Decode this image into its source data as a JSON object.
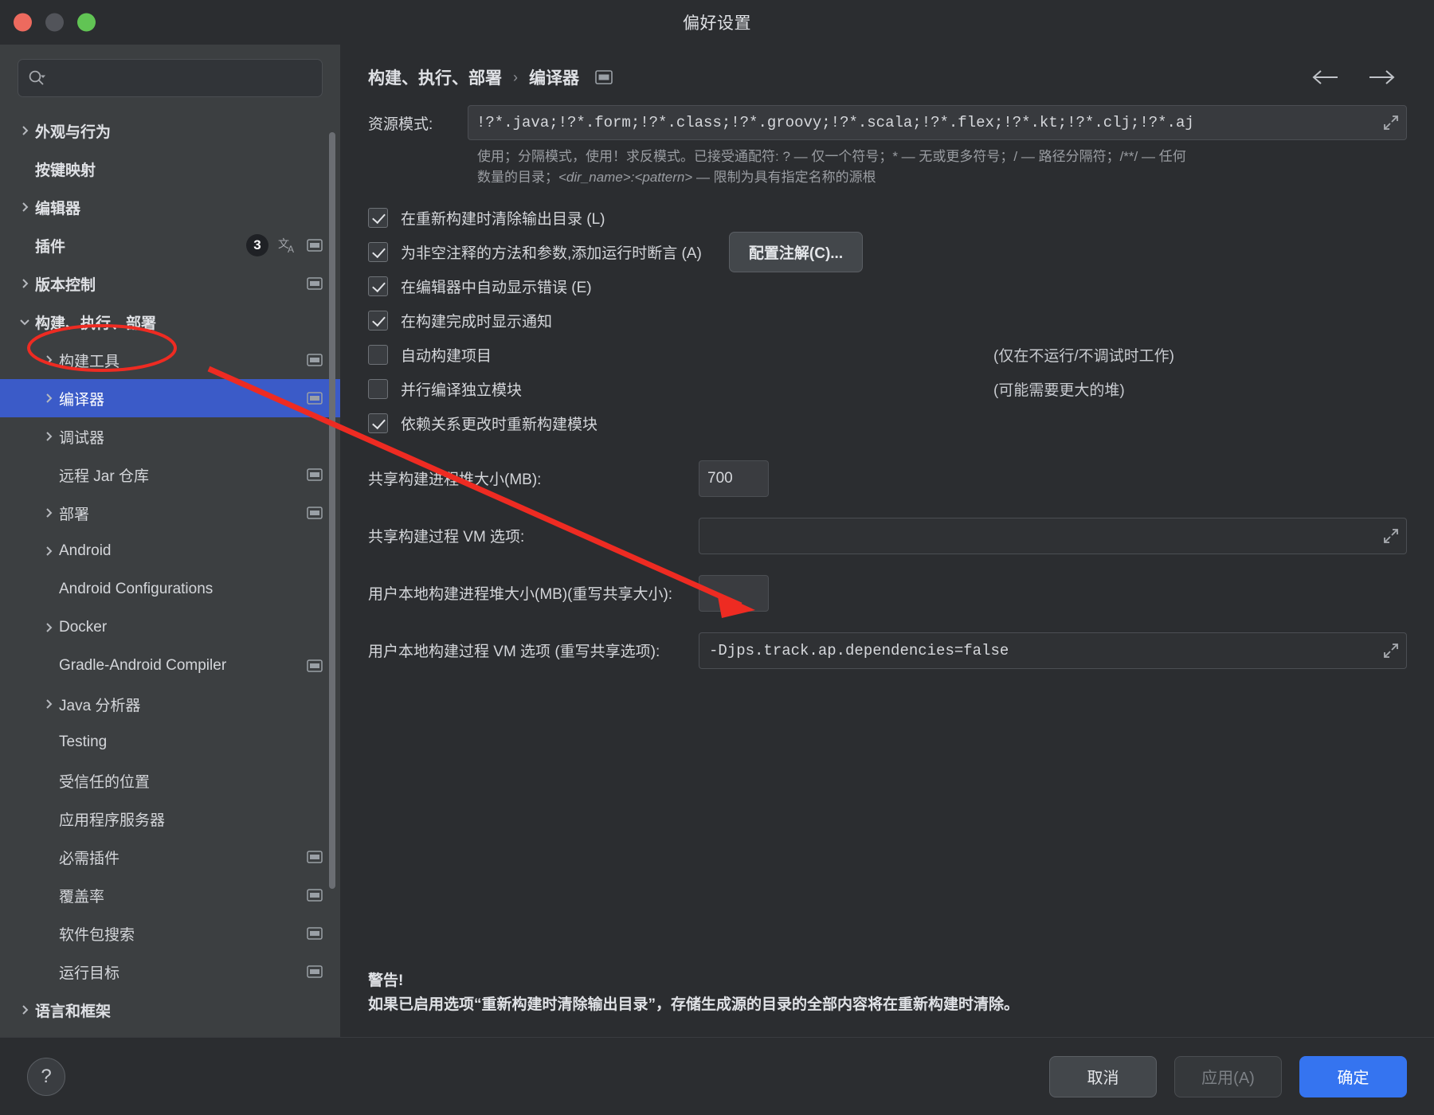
{
  "window": {
    "title": "偏好设置",
    "traffic_lights": [
      "close-red",
      "minimize-yellow",
      "zoom-green"
    ]
  },
  "sidebar": {
    "search": {
      "value": "",
      "placeholder": ""
    },
    "items": [
      {
        "label": "外观与行为",
        "level": 0,
        "chevron": "right",
        "bold": true,
        "icons": []
      },
      {
        "label": "按键映射",
        "level": 0,
        "chevron": "none",
        "bold": true,
        "icons": []
      },
      {
        "label": "编辑器",
        "level": 0,
        "chevron": "right",
        "bold": true,
        "icons": []
      },
      {
        "label": "插件",
        "level": 0,
        "chevron": "none",
        "bold": true,
        "badge": "3",
        "icons": [
          "translate-icon",
          "window-icon"
        ]
      },
      {
        "label": "版本控制",
        "level": 0,
        "chevron": "right",
        "bold": true,
        "icons": [
          "window-icon"
        ]
      },
      {
        "label": "构建、执行、部署",
        "level": 0,
        "chevron": "down",
        "bold": true,
        "icons": []
      },
      {
        "label": "构建工具",
        "level": 1,
        "chevron": "right",
        "bold": false,
        "icons": [
          "window-icon"
        ]
      },
      {
        "label": "编译器",
        "level": 1,
        "chevron": "right",
        "bold": false,
        "selected": true,
        "icons": [
          "window-icon"
        ]
      },
      {
        "label": "调试器",
        "level": 1,
        "chevron": "right",
        "bold": false,
        "icons": []
      },
      {
        "label": "远程 Jar 仓库",
        "level": 1,
        "chevron": "none",
        "bold": false,
        "icons": [
          "window-icon"
        ]
      },
      {
        "label": "部署",
        "level": 1,
        "chevron": "right",
        "bold": false,
        "icons": [
          "window-icon"
        ]
      },
      {
        "label": "Android",
        "level": 1,
        "chevron": "right",
        "bold": false,
        "icons": []
      },
      {
        "label": "Android Configurations",
        "level": 1,
        "chevron": "none",
        "bold": false,
        "icons": []
      },
      {
        "label": "Docker",
        "level": 1,
        "chevron": "right",
        "bold": false,
        "icons": []
      },
      {
        "label": "Gradle-Android Compiler",
        "level": 1,
        "chevron": "none",
        "bold": false,
        "icons": [
          "window-icon"
        ]
      },
      {
        "label": "Java 分析器",
        "level": 1,
        "chevron": "right",
        "bold": false,
        "icons": []
      },
      {
        "label": "Testing",
        "level": 1,
        "chevron": "none",
        "bold": false,
        "icons": []
      },
      {
        "label": "受信任的位置",
        "level": 1,
        "chevron": "none",
        "bold": false,
        "icons": []
      },
      {
        "label": "应用程序服务器",
        "level": 1,
        "chevron": "none",
        "bold": false,
        "icons": []
      },
      {
        "label": "必需插件",
        "level": 1,
        "chevron": "none",
        "bold": false,
        "icons": [
          "window-icon"
        ]
      },
      {
        "label": "覆盖率",
        "level": 1,
        "chevron": "none",
        "bold": false,
        "icons": [
          "window-icon"
        ]
      },
      {
        "label": "软件包搜索",
        "level": 1,
        "chevron": "none",
        "bold": false,
        "icons": [
          "window-icon"
        ]
      },
      {
        "label": "运行目标",
        "level": 1,
        "chevron": "none",
        "bold": false,
        "icons": [
          "window-icon"
        ]
      },
      {
        "label": "语言和框架",
        "level": 0,
        "chevron": "right",
        "bold": true,
        "icons": []
      }
    ]
  },
  "breadcrumb": {
    "parent": "构建、执行、部署",
    "separator": "›",
    "current": "编译器"
  },
  "nav": {
    "back": "←",
    "forward": "→"
  },
  "main": {
    "resource_patterns": {
      "label": "资源模式:",
      "value": "!?*.java;!?*.form;!?*.class;!?*.groovy;!?*.scala;!?*.flex;!?*.kt;!?*.clj;!?*.aj"
    },
    "hint_line1": "使用；分隔模式，使用！求反模式。已接受通配符: ? — 仅一个符号；* — 无或更多符号；/ — 路径分隔符；/**/ — 任何",
    "hint_line2_a": "数量的目录；",
    "hint_line2_i": "<dir_name>:<pattern>",
    "hint_line2_b": " — 限制为具有指定名称的源根",
    "checkboxes": [
      {
        "label": "在重新构建时清除输出目录 (L)",
        "checked": true,
        "note": ""
      },
      {
        "label": "为非空注释的方法和参数,添加运行时断言 (A)",
        "checked": true,
        "note": "",
        "button": "配置注解(C)..."
      },
      {
        "label": "在编辑器中自动显示错误 (E)",
        "checked": true,
        "note": ""
      },
      {
        "label": "在构建完成时显示通知",
        "checked": true,
        "note": ""
      },
      {
        "label": "自动构建项目",
        "checked": false,
        "note": "(仅在不运行/不调试时工作)"
      },
      {
        "label": "并行编译独立模块",
        "checked": false,
        "note": "(可能需要更大的堆)"
      },
      {
        "label": "依赖关系更改时重新构建模块",
        "checked": true,
        "note": ""
      }
    ],
    "fields": [
      {
        "label": "共享构建进程堆大小(MB):",
        "value": "700",
        "kind": "small"
      },
      {
        "label": "共享构建过程 VM 选项:",
        "value": "",
        "kind": "wide"
      },
      {
        "label": "用户本地构建进程堆大小(MB)(重写共享大小):",
        "value": "",
        "kind": "small"
      },
      {
        "label": "用户本地构建过程 VM 选项 (重写共享选项):",
        "value": "-Djps.track.ap.dependencies=false",
        "kind": "wide"
      }
    ],
    "warning_title": "警告!",
    "warning_body": "如果已启用选项“重新构建时清除输出目录”，存储生成源的目录的全部内容将在重新构建时清除。"
  },
  "footer": {
    "help": "?",
    "cancel": "取消",
    "apply": "应用(A)",
    "ok": "确定"
  },
  "annotations": {
    "ellipse_target": "编译器",
    "arrow_target": "-Djps.track.ap.dependencies=false",
    "color": "#ee2b22"
  }
}
